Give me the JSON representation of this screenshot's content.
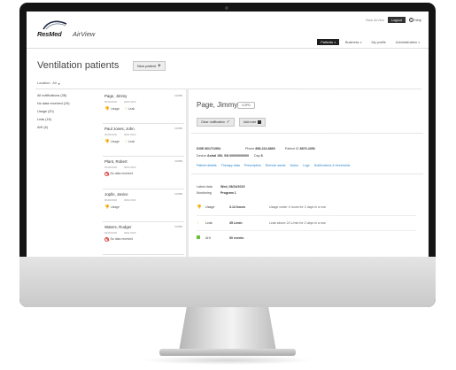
{
  "header": {
    "util_link": "Back AirView",
    "logout_label": "Logout",
    "help_label": "Help",
    "logo_resmed": "ResMed",
    "logo_airview": "AirView"
  },
  "nav": {
    "items": [
      {
        "label": "Patients",
        "active": true
      },
      {
        "label": "Business",
        "active": false
      },
      {
        "label": "My profile",
        "active": false
      },
      {
        "label": "Administration",
        "active": false
      }
    ]
  },
  "page": {
    "title": "Ventilation patients",
    "new_patient_label": "New patient",
    "location_label": "Location:",
    "location_value": "All"
  },
  "filters": [
    "All notifications (38)",
    "No data received (19)",
    "Usage (20)",
    "Leak (16)",
    "AHI (6)"
  ],
  "patients": [
    {
      "name": "Page, Jimmy",
      "device": "COPD",
      "dob": "00/00/0000",
      "id": "0000-0000",
      "alerts": [
        "Usage",
        "Leak"
      ]
    },
    {
      "name": "Paul Jones, John",
      "device": "COPD",
      "dob": "00/00/0000",
      "id": "0000-0000",
      "alerts": [
        "Usage",
        "Leak"
      ]
    },
    {
      "name": "Plant, Robert",
      "device": "COPD",
      "dob": "00/00/0000",
      "id": "0000-0000",
      "alerts": [
        "No data received"
      ]
    },
    {
      "name": "Joplin, Janice",
      "device": "COPD",
      "dob": "00/00/0000",
      "id": "0000-0000",
      "alerts": [
        "Usage"
      ]
    },
    {
      "name": "Waters, Rodger",
      "device": "COPD",
      "dob": "00/00/0000",
      "id": "0000-0000",
      "alerts": [
        "No data received"
      ]
    }
  ],
  "detail": {
    "name": "Page, Jimmy",
    "badge": "COPD",
    "clear_label": "Clear notification",
    "add_note_label": "Add note",
    "dob_label": "DOB",
    "dob_value": "06/17/1954",
    "phone_label": "Phone",
    "phone_value": "858-224-8860",
    "patient_id_label": "Patient ID",
    "patient_id_value": "8876-4356",
    "device_label": "Device",
    "device_value": "Astral 150, SN 00000000000",
    "day_label": "Day",
    "day_value": "8",
    "tabs": [
      "Patient details",
      "Therapy data",
      "Prescription",
      "Remote assist",
      "Notes",
      "Logs",
      "Notifications & thresholds"
    ],
    "latest_label": "Latest data",
    "latest_value": "Wed, 08/24/2015",
    "monitoring_label": "Monitoring",
    "monitoring_value": "Program 1",
    "stats": [
      {
        "label": "Usage",
        "value": "3.14 hours",
        "desc": "Usage under 4 hours for 2 days in a row"
      },
      {
        "label": "Leak",
        "value": "35 L/min",
        "desc": "Leak above 24 L/min for 2 days in a row"
      },
      {
        "label": "AHI",
        "value": "50 events",
        "desc": ""
      }
    ]
  },
  "colors": {
    "accent_link": "#1e7ec8",
    "alert_amber": "#e6a21b",
    "alert_red": "#d44444",
    "ok_green": "#6bbf3b"
  }
}
